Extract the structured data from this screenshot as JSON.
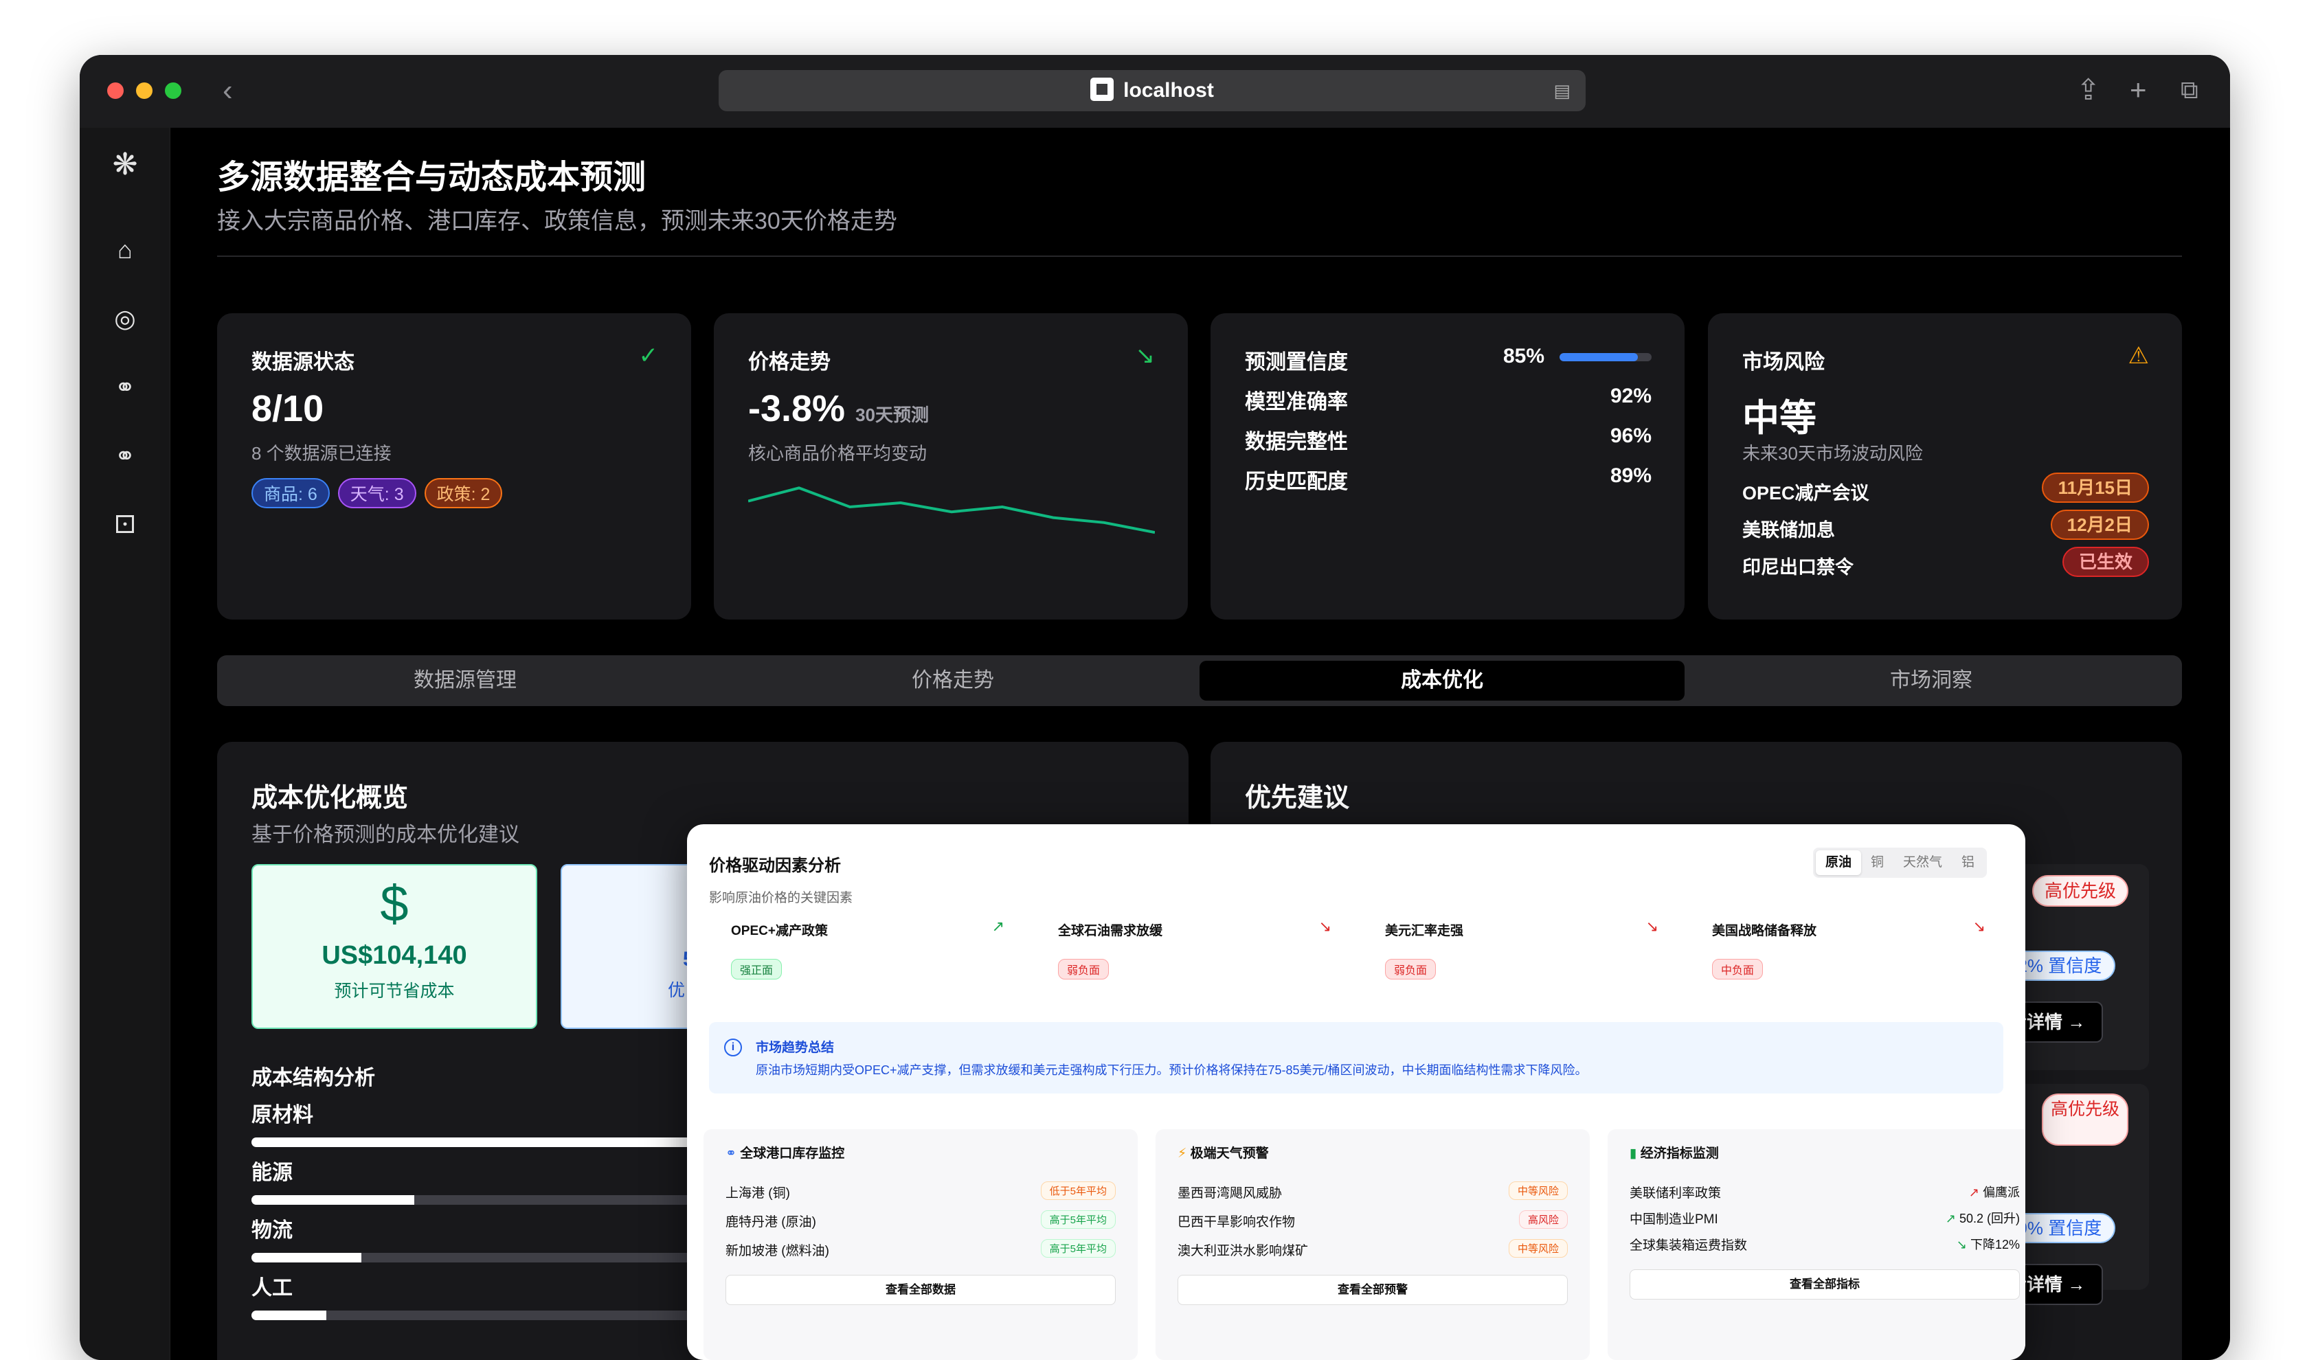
{
  "browser": {
    "url": "localhost"
  },
  "page": {
    "title": "多源数据整合与动态成本预测",
    "subtitle": "接入大宗商品价格、港口库存、政策信息，预测未来30天价格走势"
  },
  "cards": {
    "datasource": {
      "title": "数据源状态",
      "value": "8/10",
      "desc": "8 个数据源已连接",
      "chips": [
        "商品: 6",
        "天气: 3",
        "政策: 2"
      ]
    },
    "trend": {
      "title": "价格走势",
      "value": "-3.8%",
      "suffix": "30天预测",
      "desc": "核心商品价格平均变动",
      "sparkline": [
        62,
        78,
        55,
        60,
        49,
        55,
        42,
        36,
        24
      ]
    },
    "confidence": {
      "title": "预测置信度",
      "value": "85%",
      "progress": 0.85,
      "rows": [
        {
          "label": "模型准确率",
          "value": "92%"
        },
        {
          "label": "数据完整性",
          "value": "96%"
        },
        {
          "label": "历史匹配度",
          "value": "89%"
        }
      ]
    },
    "risk": {
      "title": "市场风险",
      "value": "中等",
      "desc": "未来30天市场波动风险",
      "events": [
        {
          "label": "OPEC减产会议",
          "badge": "11月15日"
        },
        {
          "label": "美联储加息",
          "badge": "12月2日"
        },
        {
          "label": "印尼出口禁令",
          "badge": "已生效"
        }
      ]
    }
  },
  "tabs": [
    "数据源管理",
    "价格走势",
    "成本优化",
    "市场洞察"
  ],
  "active_tab": "成本优化",
  "cost": {
    "title": "成本优化概览",
    "subtitle": "基于价格预测的成本优化建议",
    "savings_value": "US$104,140",
    "savings_label": "预计可节省成本",
    "savings2_value": "5",
    "savings2_label": "优",
    "structure_title": "成本结构分析",
    "structure": [
      {
        "label": "原材料",
        "fraction": 1.0
      },
      {
        "label": "能源",
        "fraction": 0.37
      },
      {
        "label": "物流",
        "fraction": 0.25
      },
      {
        "label": "人工",
        "fraction": 0.17
      }
    ]
  },
  "priority": {
    "title": "优先建议",
    "items": [
      {
        "badge": "高优先级",
        "confidence": "92% 置信度",
        "action": "查看详情"
      },
      {
        "badge": "高优先级",
        "confidence": "89% 置信度",
        "action": "查看详情"
      }
    ]
  },
  "overlay": {
    "title": "价格驱动因素分析",
    "subtitle": "影响原油价格的关键因素",
    "segments": [
      "原油",
      "铜",
      "天然气",
      "铝"
    ],
    "active_segment": "原油",
    "factors": [
      {
        "name": "OPEC+减产政策",
        "tag": "强正面",
        "dir": "up"
      },
      {
        "name": "全球石油需求放缓",
        "tag": "弱负面",
        "dir": "down"
      },
      {
        "name": "美元汇率走强",
        "tag": "弱负面",
        "dir": "down"
      },
      {
        "name": "美国战略储备释放",
        "tag": "中负面",
        "dir": "down"
      }
    ],
    "summary_title": "市场趋势总结",
    "summary_text": "原油市场短期内受OPEC+减产支撑，但需求放缓和美元走强构成下行压力。预计价格将保持在75-85美元/桶区间波动，中长期面临结构性需求下降风险。",
    "port": {
      "title": "全球港口库存监控",
      "rows": [
        {
          "label": "上海港 (铜)",
          "tag": "低于5年平均"
        },
        {
          "label": "鹿特丹港 (原油)",
          "tag": "高于5年平均"
        },
        {
          "label": "新加坡港 (燃料油)",
          "tag": "高于5年平均"
        }
      ],
      "button": "查看全部数据"
    },
    "weather": {
      "title": "极端天气预警",
      "rows": [
        {
          "label": "墨西哥湾飓风威胁",
          "tag": "中等风险"
        },
        {
          "label": "巴西干旱影响农作物",
          "tag": "高风险"
        },
        {
          "label": "澳大利亚洪水影响煤矿",
          "tag": "中等风险"
        }
      ],
      "button": "查看全部预警"
    },
    "econ": {
      "title": "经济指标监测",
      "rows": [
        {
          "label": "美联储利率政策",
          "value": "偏鹰派"
        },
        {
          "label": "中国制造业PMI",
          "value": "50.2 (回升)"
        },
        {
          "label": "全球集装箱运费指数",
          "value": "下降12%"
        }
      ],
      "button": "查看全部指标"
    }
  }
}
